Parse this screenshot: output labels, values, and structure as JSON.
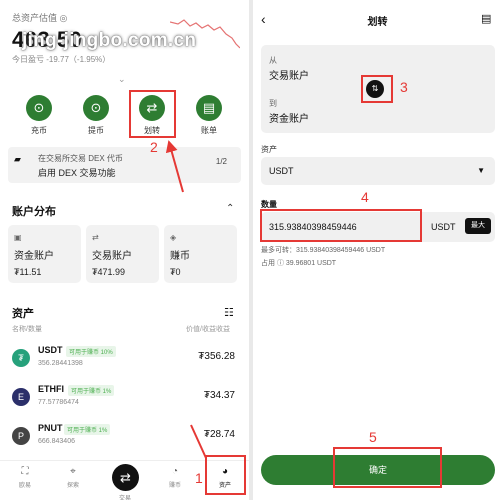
{
  "left": {
    "total_label": "总资产估值 ◎",
    "total_value": "463.50",
    "today_pnl": "今日盈亏 -19.77（-1.95%）",
    "watermark": "jing-jingbo.com.cn",
    "actions": [
      {
        "label": "充币",
        "icon": "⊙"
      },
      {
        "label": "提币",
        "icon": "⊙"
      },
      {
        "label": "划转",
        "icon": "⇄"
      },
      {
        "label": "账单",
        "icon": "▤"
      }
    ],
    "dex": {
      "line1": "在交易所交易 DEX 代币",
      "line2": "启用 DEX 交易功能",
      "page": "1/2"
    },
    "account_title": "账户分布",
    "accounts": [
      {
        "name": "资金账户",
        "value": "₮11.51",
        "icon": "▣"
      },
      {
        "name": "交易账户",
        "value": "₮471.99",
        "icon": "⇄"
      },
      {
        "name": "赚币",
        "value": "₮0",
        "icon": "◈"
      }
    ],
    "assets_title": "资产",
    "col_left": "名称/数量",
    "col_right": "价值/收益收益",
    "assets": [
      {
        "symbol": "USDT",
        "tag": "可用于赚币 10%",
        "qty": "356.28441398",
        "amount": "₮356.28",
        "color": "#26a17b",
        "letter": "₮"
      },
      {
        "symbol": "ETHFI",
        "tag": "可用于赚币 1%",
        "qty": "77.57786474",
        "amount": "₮34.37",
        "color": "#2b2f6a",
        "letter": "E"
      },
      {
        "symbol": "PNUT",
        "tag": "可用于赚币 1%",
        "qty": "666.843406",
        "amount": "₮28.74",
        "color": "#444",
        "letter": "P"
      }
    ],
    "nav": [
      {
        "label": "欧易",
        "icon": "⛶"
      },
      {
        "label": "探索",
        "icon": "⌖"
      },
      {
        "label": "交易",
        "icon": "⇄"
      },
      {
        "label": "赚币",
        "icon": "◔"
      },
      {
        "label": "资产",
        "icon": "◕"
      }
    ]
  },
  "right": {
    "title": "划转",
    "from_label": "从",
    "from_value": "交易账户",
    "to_label": "到",
    "to_value": "资金账户",
    "asset_label": "资产",
    "asset_value": "USDT",
    "qty_label": "数量",
    "qty_value": "315.93840398459446",
    "qty_unit": "USDT",
    "max_label": "最大",
    "available": "最多可转：315.93840398459446 USDT",
    "occupied": "占用 ⓘ  39.96801 USDT",
    "confirm": "确定"
  },
  "annotations": {
    "step1": "1",
    "step2": "2",
    "step3": "3",
    "step4": "4",
    "step5": "5",
    "color": "#e53935"
  }
}
